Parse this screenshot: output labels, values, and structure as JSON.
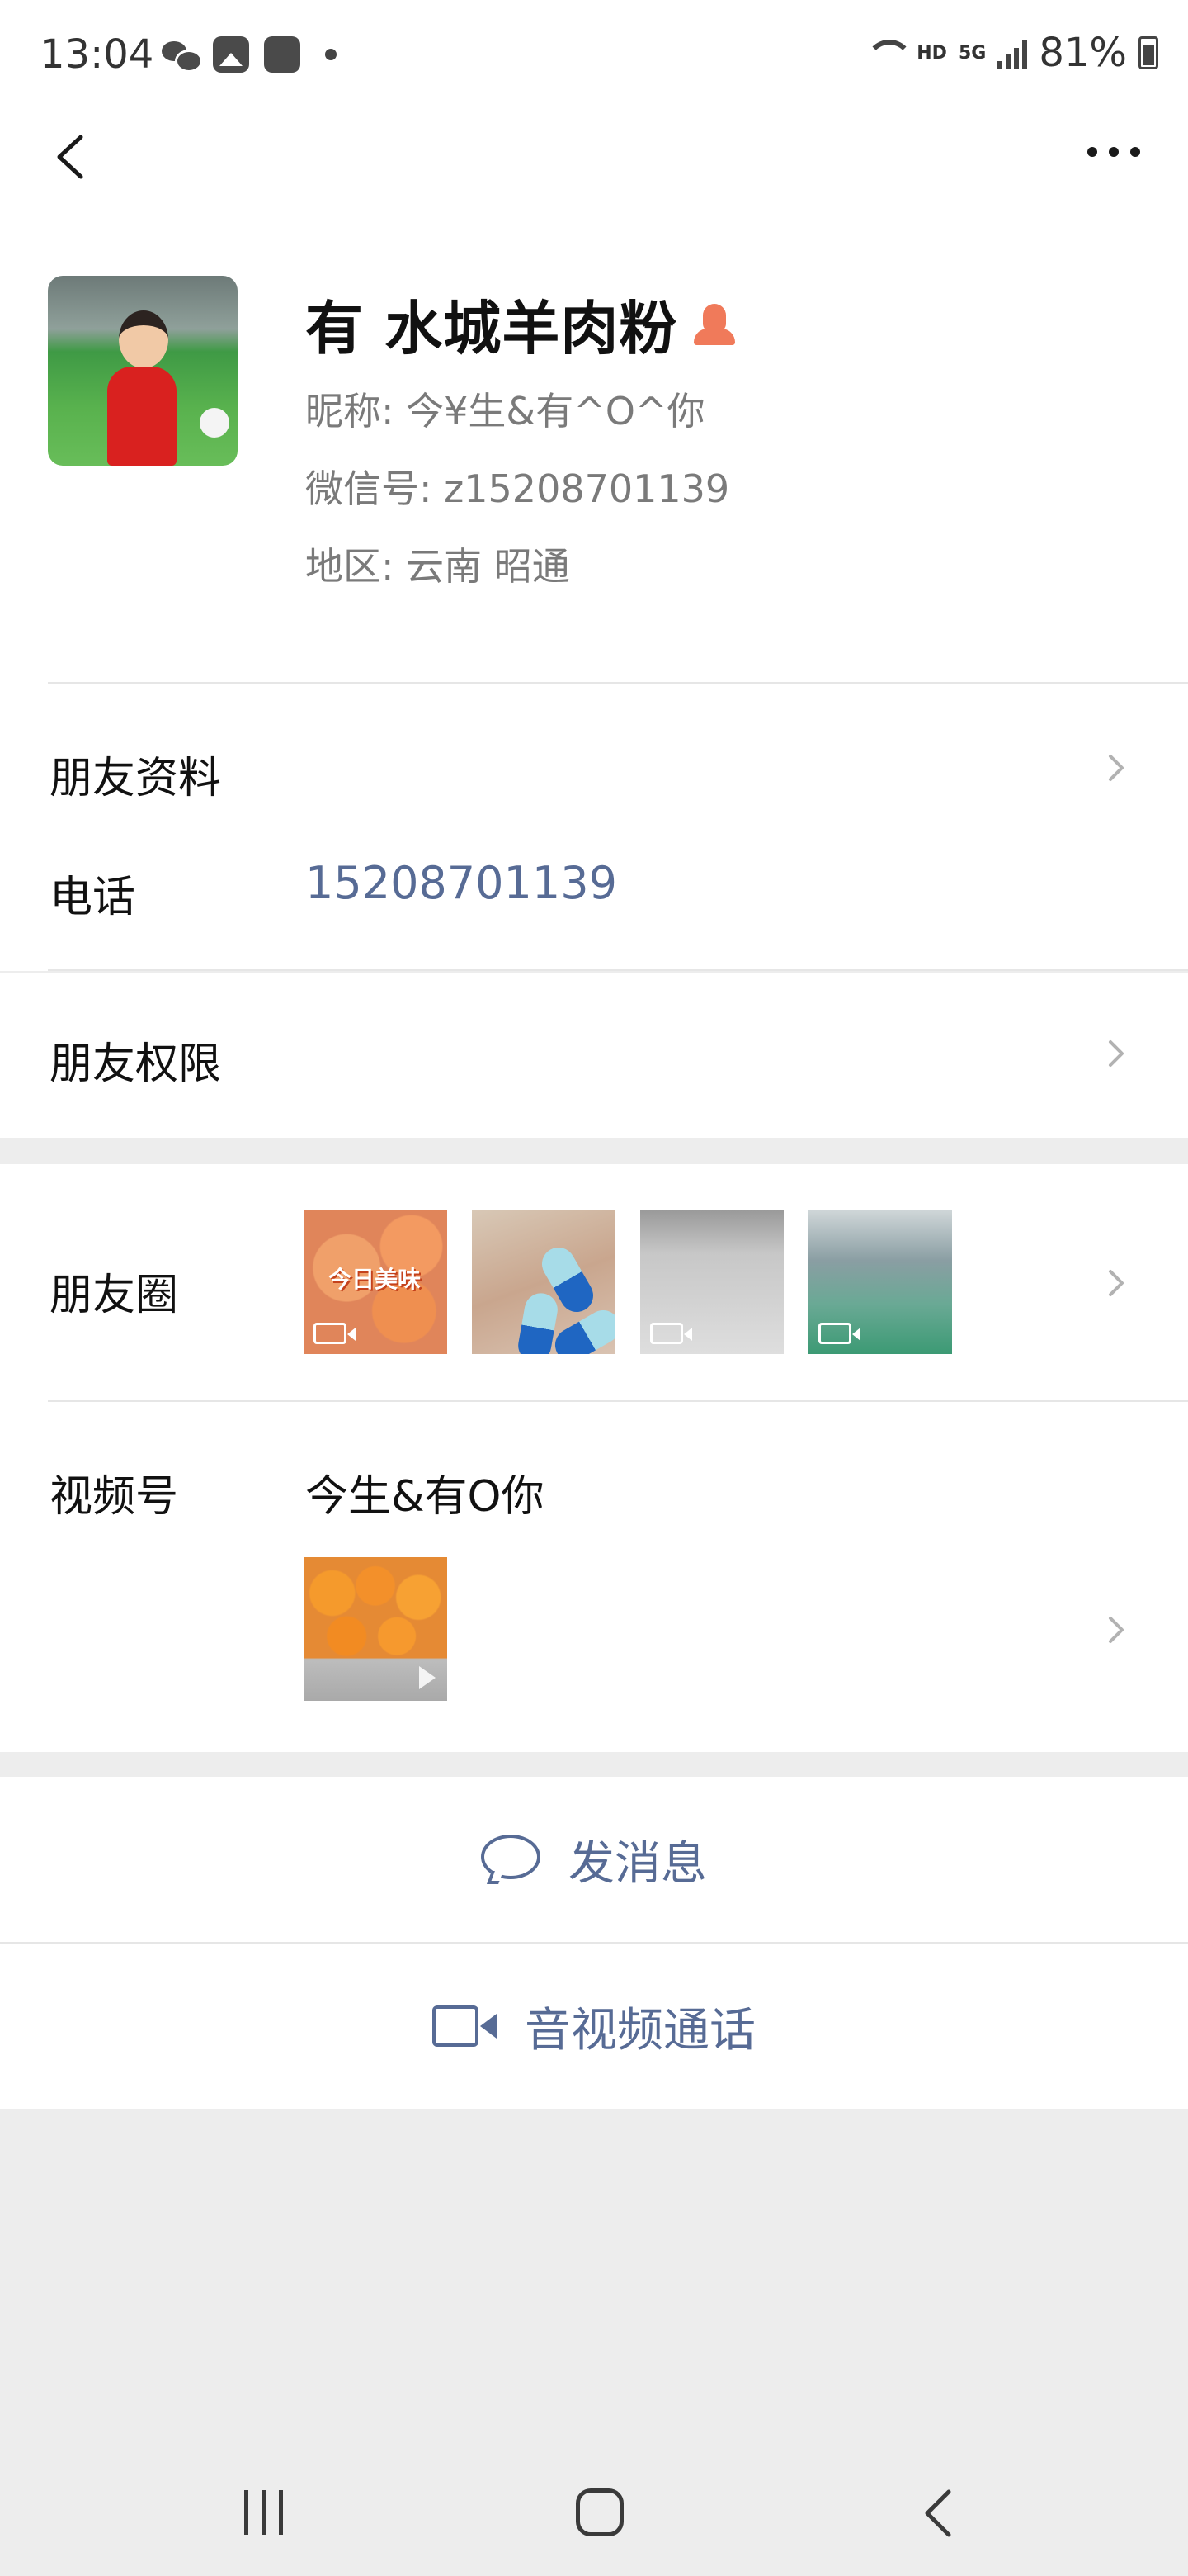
{
  "status_bar": {
    "time": "13:04",
    "network_label": "HD",
    "network_gen": "5G",
    "battery": "81%"
  },
  "nav": {
    "back_icon": "back-chevron-icon",
    "more_icon": "more-dots-icon"
  },
  "profile": {
    "name": "有 水城羊肉粉",
    "gender_icon": "female-gender-icon",
    "nickname": "昵称:  今¥生&有^O^你",
    "wechat_id": "微信号:  z15208701139",
    "region": "地区:  云南  昭通"
  },
  "friend_info": {
    "label": "朋友资料"
  },
  "phone": {
    "label": "电话",
    "value": "15208701139"
  },
  "permissions": {
    "label": "朋友权限"
  },
  "moments": {
    "label": "朋友圈",
    "thumb_caption": "今日美味"
  },
  "channels": {
    "label": "视频号",
    "name": "今生&有O你"
  },
  "actions": {
    "message_label": "发消息",
    "call_label": "音视频通话"
  },
  "colors": {
    "link": "#576b95",
    "background": "#ededed",
    "accent_gender": "#f07a5a"
  }
}
